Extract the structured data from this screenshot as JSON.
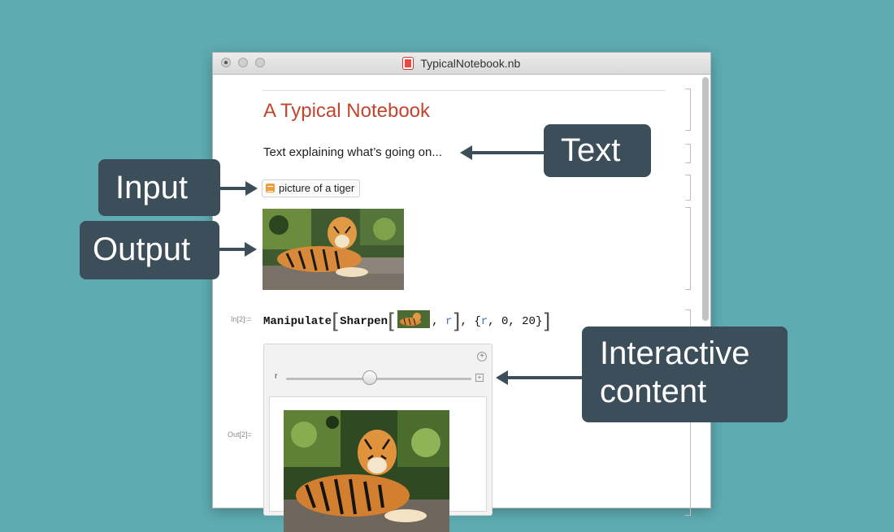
{
  "window": {
    "title": "TypicalNotebook.nb"
  },
  "notebook": {
    "title": "A Typical Notebook",
    "text": "Text explaining what’s going on...",
    "input_query": "picture of a tiger",
    "in_label": "In[2]:=",
    "out_label": "Out[2]=",
    "code": {
      "func1": "Manipulate",
      "func2": "Sharpen",
      "var": "r",
      "list_open": "{",
      "list_var": "r",
      "list_rest": ", 0, 20}"
    },
    "manipulate": {
      "slider_label": "r",
      "slider_value_fraction": 0.45
    }
  },
  "callouts": {
    "text": "Text",
    "input": "Input",
    "output": "Output",
    "interactive_line1": "Interactive",
    "interactive_line2": "content"
  },
  "icons": {
    "notebook_doc": "notebook-file-icon",
    "free_form_input": "free-form-input-icon",
    "plus": "add-icon",
    "expand": "expand-icon"
  },
  "colors": {
    "background": "#5eabb1",
    "callout": "#3d4e5b",
    "title_accent": "#c1462d",
    "variable": "#3a7ec6",
    "input_icon": "#f39c3c"
  }
}
